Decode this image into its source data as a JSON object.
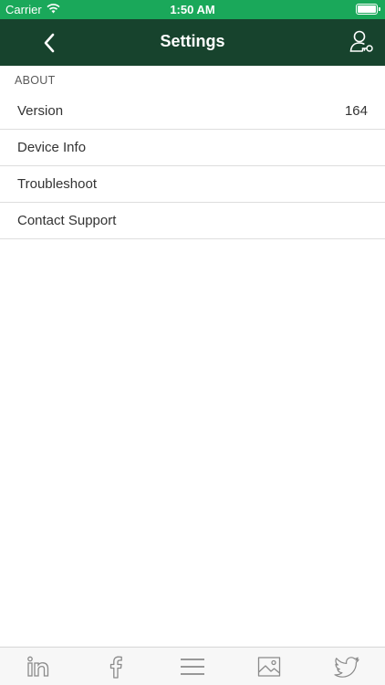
{
  "status_bar": {
    "carrier": "Carrier",
    "time": "1:50 AM",
    "wifi_icon": "wifi-icon",
    "battery_icon": "battery-icon"
  },
  "nav_bar": {
    "title": "Settings",
    "back_icon": "chevron-left-icon",
    "account_icon": "user-key-icon",
    "background": "#17432d"
  },
  "about": {
    "header": "ABOUT",
    "rows": [
      {
        "label": "Version",
        "value": "164"
      },
      {
        "label": "Device Info"
      },
      {
        "label": "Troubleshoot"
      },
      {
        "label": "Contact Support"
      }
    ]
  },
  "tab_bar": {
    "tabs": [
      "linkedin-icon",
      "facebook-icon",
      "menu-icon",
      "gallery-icon",
      "twitter-icon"
    ]
  },
  "colors": {
    "status_bar": "#1aa85a",
    "icon_gray": "#8a8a8a"
  }
}
